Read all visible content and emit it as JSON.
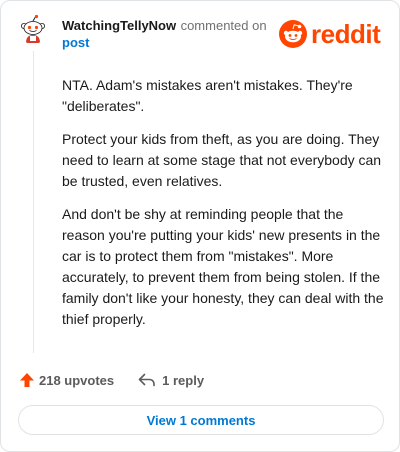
{
  "header": {
    "username": "WatchingTellyNow",
    "action_text": "commented on",
    "post_link": "post",
    "logo_text": "reddit",
    "avatar_icon": "snoo-avatar-icon",
    "logo_icon": "reddit-snoo-icon"
  },
  "comment": {
    "paragraphs": [
      "NTA. Adam's mistakes aren't mistakes. They're \"deliberates\".",
      "Protect your kids from theft, as you are doing. They need to learn at some stage that not everybody can be trusted, even relatives.",
      "And don't be shy at reminding people that the reason you're putting your kids' new presents in the car is to protect them from \"mistakes\". More accurately, to prevent them from being stolen. If the family don't like your honesty, they can deal with the thief properly."
    ]
  },
  "footer": {
    "upvotes_label": "218 upvotes",
    "reply_label": "1 reply",
    "view_comments_label": "View 1 comments",
    "upvote_icon": "upvote-arrow-icon",
    "reply_icon": "reply-arrow-icon"
  },
  "colors": {
    "brand": "#ff4500",
    "link": "#0079d3",
    "muted": "#707070"
  }
}
